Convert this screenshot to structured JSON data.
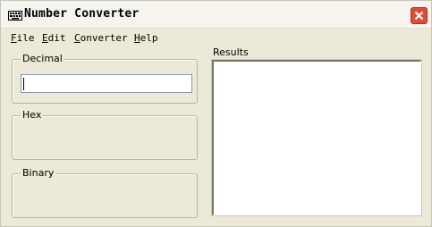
{
  "window": {
    "title": "Number Converter",
    "icon": "keyboard-icon",
    "close": "close-icon"
  },
  "menu": {
    "items": [
      {
        "accel": "F",
        "rest": "ile"
      },
      {
        "accel": "E",
        "rest": "dit"
      },
      {
        "accel": "C",
        "rest": "onverter"
      },
      {
        "accel": "H",
        "rest": "elp"
      }
    ]
  },
  "groups": {
    "decimal": {
      "label": "Decimal",
      "value": ""
    },
    "hex": {
      "label": "Hex"
    },
    "binary": {
      "label": "Binary"
    }
  },
  "results": {
    "label": "Results",
    "text": ""
  },
  "colors": {
    "window_bg": "#ece9d8",
    "close_button": "#d8503c"
  }
}
